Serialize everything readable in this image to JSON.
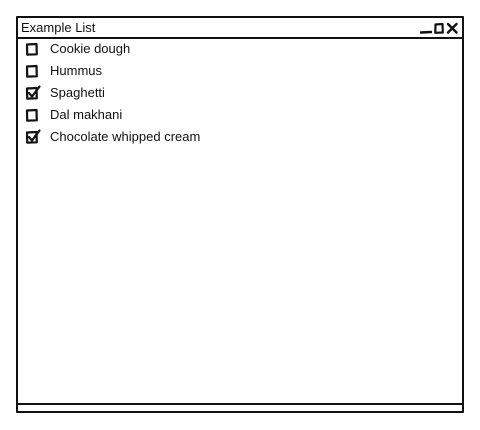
{
  "window": {
    "title": "Example List",
    "controls": [
      {
        "name": "minimize-icon"
      },
      {
        "name": "maximize-icon"
      },
      {
        "name": "close-icon"
      }
    ]
  },
  "list": {
    "items": [
      {
        "label": "Cookie dough",
        "checked": false
      },
      {
        "label": "Hummus",
        "checked": false
      },
      {
        "label": "Spaghetti",
        "checked": true
      },
      {
        "label": "Dal makhani",
        "checked": false
      },
      {
        "label": "Chocolate whipped cream",
        "checked": true
      }
    ]
  },
  "colors": {
    "stroke": "#111111",
    "background": "#ffffff"
  }
}
